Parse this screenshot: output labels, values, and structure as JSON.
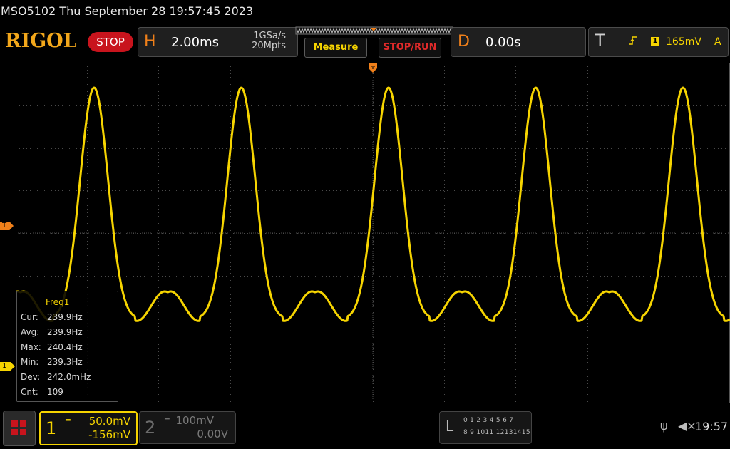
{
  "status_line": "MSO5102  Thu September 28 19:57:45 2023",
  "logo": "RIGOL",
  "run_state": "STOP",
  "horizontal": {
    "letter": "H",
    "timebase": "2.00ms",
    "sample_rate": "1GSa/s",
    "memory_depth": "20Mpts"
  },
  "buttons": {
    "measure": "Measure",
    "stop_run": "STOP/RUN"
  },
  "delay": {
    "letter": "D",
    "value": "0.00s"
  },
  "trigger": {
    "letter": "T",
    "source": "1",
    "level": "165mV",
    "mode": "A"
  },
  "markers": {
    "trigger_level": "T",
    "channel1": "1"
  },
  "measurement": {
    "title": "Freq1",
    "rows": [
      {
        "label": "Cur:",
        "value": "239.9Hz"
      },
      {
        "label": "Avg:",
        "value": "239.9Hz"
      },
      {
        "label": "Max:",
        "value": "240.4Hz"
      },
      {
        "label": "Min:",
        "value": "239.3Hz"
      },
      {
        "label": "Dev:",
        "value": "242.0mHz"
      },
      {
        "label": "Cnt:",
        "value": "109"
      }
    ]
  },
  "channel1": {
    "number": "1",
    "scale": "50.0mV",
    "offset": "-156mV"
  },
  "channel2": {
    "number": "2",
    "scale": "100mV",
    "offset": "0.00V"
  },
  "logic": {
    "letter": "L",
    "row1": "0 1 2 3  4 5 6 7",
    "row2": "8 9 1011 12131415"
  },
  "system": {
    "clock": "19:57"
  },
  "colors": {
    "ch1": "#f6d400",
    "accent": "#f0801a",
    "stop": "#c8141d",
    "grid": "#4a4a4a"
  },
  "icons": {
    "usb": "usb-icon",
    "speaker": "speaker-muted-icon",
    "home": "home-grid-icon"
  }
}
